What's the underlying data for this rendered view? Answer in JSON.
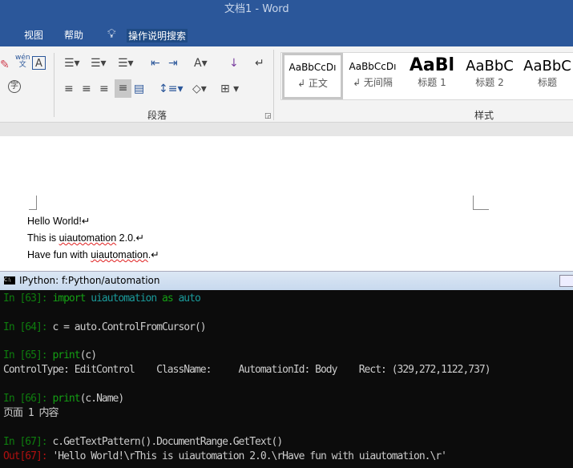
{
  "window": {
    "title": "文档1  -  Word"
  },
  "menu": {
    "items": [
      "视图",
      "帮助"
    ],
    "search": "操作说明搜索"
  },
  "ribbon": {
    "paragraph_label": "段落",
    "styles_label": "样式",
    "styles": [
      {
        "preview": "AaBbCcDı",
        "name": "↲ 正文"
      },
      {
        "preview": "AaBbCcDı",
        "name": "↲ 无间隔"
      },
      {
        "preview": "AaBl",
        "name": "标题 1"
      },
      {
        "preview": "AaBbC",
        "name": "标题 2"
      },
      {
        "preview": "AaBbC",
        "name": "标题"
      }
    ],
    "font_glyph": "wén\n文"
  },
  "document": {
    "lines": [
      "Hello World!↵",
      "This is uiautomation 2.0.↵",
      "Have fun with uiautomation.↵"
    ]
  },
  "console": {
    "title": "IPython: f:Python/automation",
    "lines": [
      {
        "prompt": "In [63]: ",
        "parts": [
          [
            "kw",
            "import "
          ],
          [
            "tl",
            "uiautomation "
          ],
          [
            "kw",
            "as "
          ],
          [
            "tl",
            "auto"
          ]
        ]
      },
      {
        "prompt": "In [64]: ",
        "parts": [
          [
            "",
            "c = auto.ControlFromCursor()"
          ]
        ]
      },
      {
        "prompt": "In [65]: ",
        "parts": [
          [
            "kw",
            "print"
          ],
          [
            "",
            "(c)"
          ]
        ]
      },
      {
        "prompt": "",
        "parts": [
          [
            "",
            "ControlType: EditControl    ClassName:     AutomationId: Body    Rect: (329,272,1122,737)"
          ]
        ]
      },
      {
        "prompt": "In [66]: ",
        "parts": [
          [
            "kw",
            "print"
          ],
          [
            "",
            "(c.Name)"
          ]
        ]
      },
      {
        "prompt": "",
        "parts": [
          [
            "",
            "页面 1 内容"
          ]
        ]
      },
      {
        "prompt": "In [67]: ",
        "parts": [
          [
            "",
            "c.GetTextPattern().DocumentRange.GetText()"
          ]
        ]
      },
      {
        "prompt": "Out[67]: ",
        "out": true,
        "parts": [
          [
            "",
            "'Hello World!\\rThis is uiautomation 2.0.\\rHave fun with uiautomation.\\r'"
          ]
        ]
      }
    ]
  }
}
